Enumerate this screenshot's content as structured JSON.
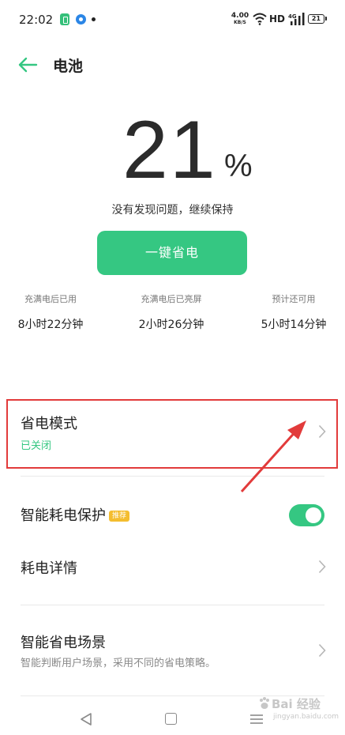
{
  "status_bar": {
    "time": "22:02",
    "net_speed": "4.00",
    "net_speed_unit": "KB/S",
    "hd_label": "HD",
    "signal_label": "4G",
    "battery_text": "21"
  },
  "header": {
    "title": "电池"
  },
  "battery": {
    "level": "21",
    "unit": "%",
    "status_message": "没有发现问题，继续保持",
    "power_save_button": "一键省电"
  },
  "stats": [
    {
      "label": "充满电后已用",
      "value": "8小时22分钟"
    },
    {
      "label": "充满电后已亮屏",
      "value": "2小时26分钟"
    },
    {
      "label": "预计还可用",
      "value": "5小时14分钟"
    }
  ],
  "settings": {
    "power_save_mode": {
      "title": "省电模式",
      "status": "已关闭"
    },
    "smart_protection": {
      "title": "智能耗电保护",
      "badge": "推荐",
      "enabled": true
    },
    "consumption_details": {
      "title": "耗电详情"
    },
    "smart_scenes": {
      "title": "智能省电场景",
      "description": "智能判断用户场景，采用不同的省电策略。"
    }
  },
  "watermark": {
    "brand": "Bai 经验",
    "url": "jingyan.baidu.com"
  },
  "colors": {
    "accent_green": "#35c782",
    "annotation_red": "#e23b3b",
    "badge_yellow": "#f4bd2f"
  }
}
